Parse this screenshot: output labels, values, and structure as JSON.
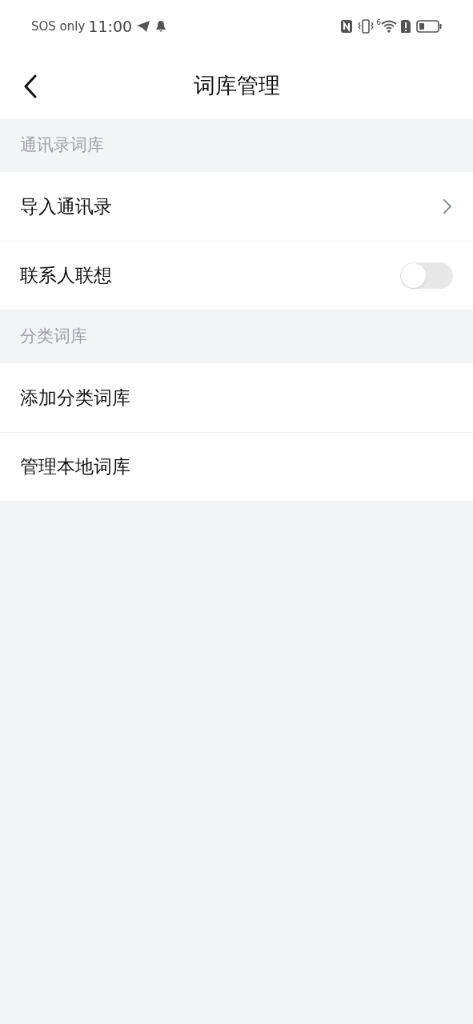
{
  "status_bar": {
    "carrier": "SOS only",
    "time": "11:00",
    "wifi_badge": "6"
  },
  "header": {
    "title": "词库管理"
  },
  "sections": [
    {
      "title": "通讯录词库",
      "items": [
        {
          "label": "导入通讯录",
          "kind": "chevron"
        },
        {
          "label": "联系人联想",
          "kind": "toggle",
          "on": false
        }
      ]
    },
    {
      "title": "分类词库",
      "items": [
        {
          "label": "添加分类词库",
          "kind": "plain"
        },
        {
          "label": "管理本地词库",
          "kind": "plain"
        }
      ]
    }
  ]
}
